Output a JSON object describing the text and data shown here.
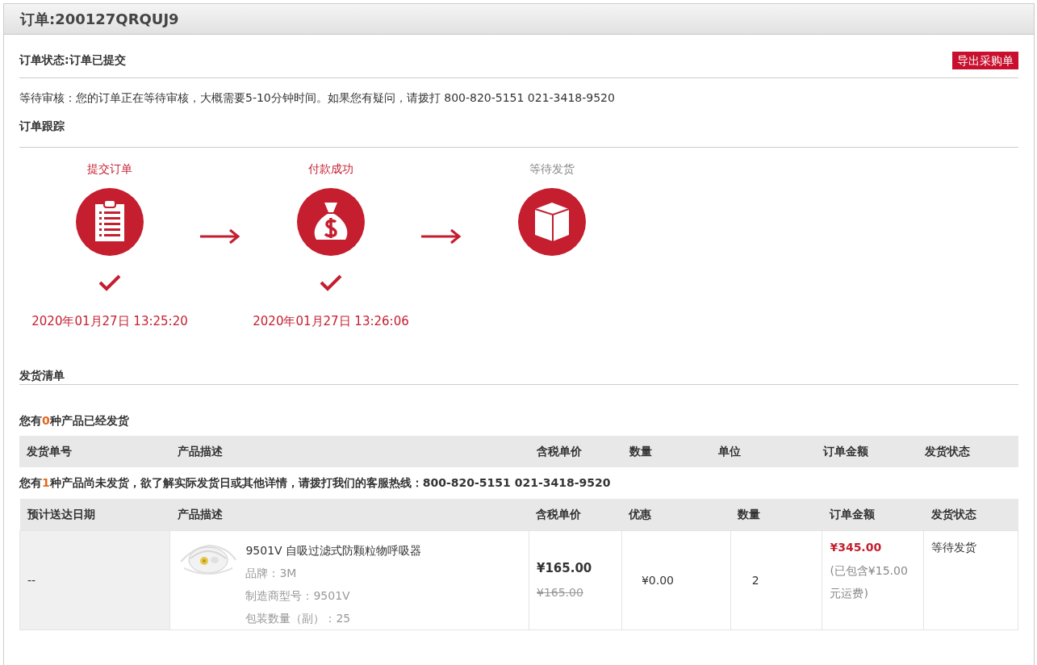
{
  "order": {
    "title": "订单:200127QRQUJ9"
  },
  "status": {
    "text": "订单状态:订单已提交",
    "export_button": "导出采购单"
  },
  "notice": "等待审核：您的订单正在等待审核，大概需要5-10分钟时间。如果您有疑问，请拨打 800-820-5151 021-3418-9520",
  "tracking": {
    "title": "订单跟踪",
    "steps": [
      {
        "label": "提交订单",
        "kind": "clipboard",
        "done": true,
        "time": "2020年01月27日 13:25:20"
      },
      {
        "label": "付款成功",
        "kind": "money-bag",
        "done": true,
        "time": "2020年01月27日 13:26:06"
      },
      {
        "label": "等待发货",
        "kind": "box",
        "done": false
      }
    ]
  },
  "shipping": {
    "title": "发货清单",
    "shipped_notice": {
      "prefix": "您有",
      "count": "0",
      "suffix": "种产品已经发货"
    },
    "shipped_table": {
      "columns": [
        "发货单号",
        "产品描述",
        "含税单价",
        "数量",
        "单位",
        "订单金额",
        "发货状态"
      ]
    },
    "unshipped_notice": {
      "prefix": "您有",
      "count": "1",
      "suffix": "种产品尚未发货，欲了解实际发货日或其他详情，请拨打我们的客服热线：800-820-5151 021-3418-9520"
    },
    "unshipped_table": {
      "columns": [
        "预计送达日期",
        "产品描述",
        "含税单价",
        "优惠",
        "数量",
        "订单金额",
        "发货状态"
      ],
      "rows": [
        {
          "delivery_date": "--",
          "product": {
            "kind": "picture",
            "name": "9501V 自吸过滤式防颗粒物呼吸器",
            "details": [
              "品牌：3M",
              "制造商型号：9501V",
              "包装数量（副）：25"
            ]
          },
          "price": "¥165.00",
          "original_price": "¥165.00",
          "discount": "¥0.00",
          "quantity": "2",
          "amount": "¥345.00",
          "amount_note": "(已包含¥15.00元运费)",
          "status": "等待发货"
        }
      ]
    }
  }
}
